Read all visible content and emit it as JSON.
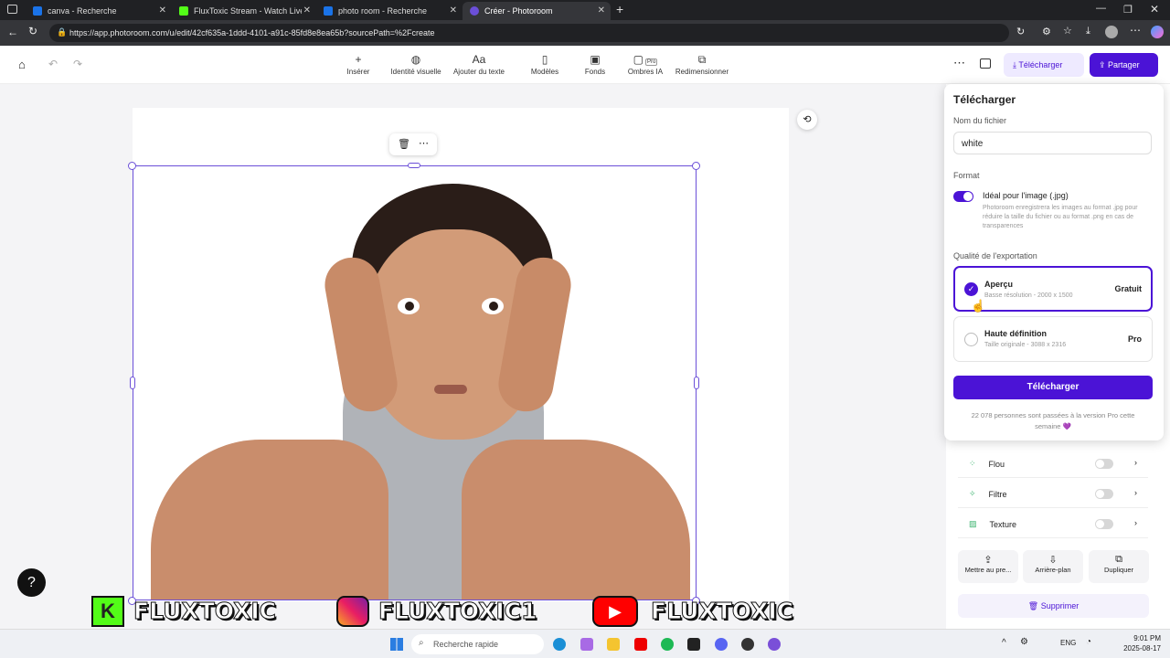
{
  "browser": {
    "tabs": [
      {
        "title": "canva - Recherche"
      },
      {
        "title": "FluxToxic Stream - Watch Live on"
      },
      {
        "title": "photo room - Recherche"
      },
      {
        "title": "Créer - Photoroom"
      }
    ],
    "url": "https://app.photoroom.com/u/edit/42cf635a-1ddd-4101-a91c-85fd8e8ea65b?sourcePath=%2Fcreate"
  },
  "toolbar": {
    "items": [
      {
        "label": "Insérer",
        "icon": "plus-icon"
      },
      {
        "label": "Identité visuelle",
        "icon": "brand-icon"
      },
      {
        "label": "Ajouter du texte",
        "icon": "text-icon"
      },
      {
        "label": "Modèles",
        "icon": "template-icon"
      },
      {
        "label": "Fonds",
        "icon": "background-icon"
      },
      {
        "label": "Ombres IA",
        "icon": "shadow-icon",
        "badge": "Pro"
      },
      {
        "label": "Redimensionner",
        "icon": "resize-icon"
      }
    ],
    "download_label": "Télécharger",
    "share_label": "Partager"
  },
  "download_panel": {
    "title": "Télécharger",
    "filename_label": "Nom du fichier",
    "filename_value": "white",
    "format_label": "Format",
    "format_option": "Idéal pour l'image (.jpg)",
    "format_desc": "Photoroom enregistrera les images au format .jpg pour réduire la taille du fichier ou au format .png en cas de transparences",
    "quality_label": "Qualité de l'exportation",
    "options": [
      {
        "title": "Aperçu",
        "sub": "Basse résolution - 2000 x 1500",
        "tag": "Gratuit"
      },
      {
        "title": "Haute définition",
        "sub": "Taille originale - 3088 x 2316",
        "tag": "Pro"
      }
    ],
    "button": "Télécharger",
    "footer": "22 078 personnes sont passées à la version Pro cette semaine 💜"
  },
  "effects": [
    {
      "label": "Flou"
    },
    {
      "label": "Filtre"
    },
    {
      "label": "Texture"
    }
  ],
  "actions": [
    {
      "label": "Mettre au pre..."
    },
    {
      "label": "Arrière-plan"
    },
    {
      "label": "Dupliquer"
    }
  ],
  "delete_label": "Supprimer",
  "overlay": {
    "kick_name": "FLUXTOXIC",
    "instagram_name": "FLUXTOXIC1",
    "youtube_name": "FLUXTOXIC"
  },
  "taskbar": {
    "search_placeholder": "Recherche rapide",
    "lang": "ENG",
    "time": "9:01 PM",
    "date": "2025-08-17"
  },
  "colors": {
    "accent": "#4b13d6",
    "kick": "#53fc18",
    "youtube": "#ff0000"
  }
}
